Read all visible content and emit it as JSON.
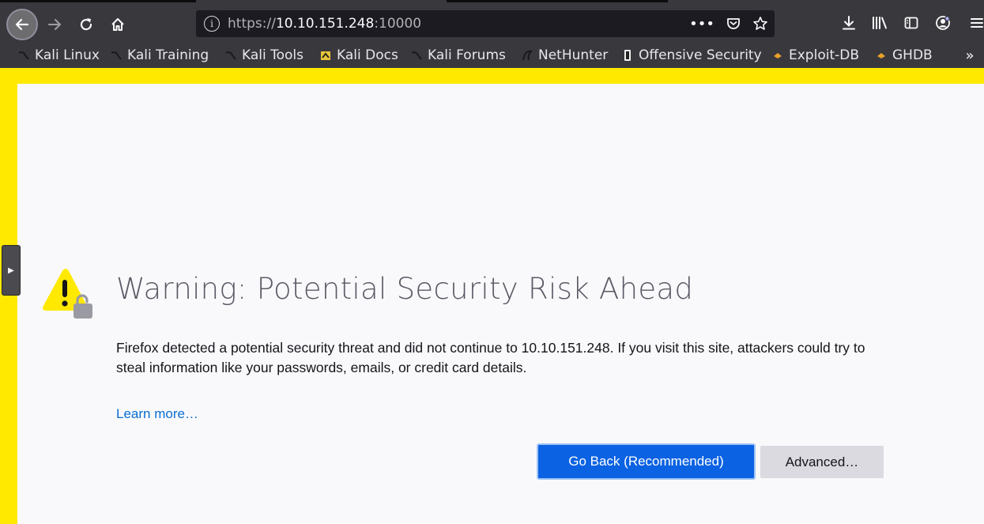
{
  "toolbar": {
    "back_icon": "back-arrow-icon",
    "forward_icon": "forward-arrow-icon",
    "reload_icon": "reload-icon",
    "home_icon": "home-icon"
  },
  "urlbar": {
    "scheme": "https://",
    "host": "10.10.151.248",
    "port": ":10000"
  },
  "bookmarks": [
    {
      "label": "Kali Linux",
      "icon": "kali-dragon-icon"
    },
    {
      "label": "Kali Training",
      "icon": "kali-dragon-icon"
    },
    {
      "label": "Kali Tools",
      "icon": "kali-dragon-icon"
    },
    {
      "label": "Kali Docs",
      "icon": "kali-docs-icon"
    },
    {
      "label": "Kali Forums",
      "icon": "kali-dragon-icon"
    },
    {
      "label": "NetHunter",
      "icon": "nethunter-icon"
    },
    {
      "label": "Offensive Security",
      "icon": "offsec-icon"
    },
    {
      "label": "Exploit-DB",
      "icon": "exploitdb-icon"
    },
    {
      "label": "GHDB",
      "icon": "exploitdb-icon"
    }
  ],
  "page": {
    "title": "Warning: Potential Security Risk Ahead",
    "description": "Firefox detected a potential security threat and did not continue to 10.10.151.248. If you visit this site, attackers could try to steal information like your passwords, emails, or credit card details.",
    "learn_more": "Learn more…",
    "go_back_label": "Go Back (Recommended)",
    "advanced_label": "Advanced…"
  },
  "colors": {
    "toolbar": "#38383d",
    "urlbar": "#1c1b22",
    "warning_border": "#ffe900",
    "primary_button": "#0b62e3",
    "link": "#0a6ed4"
  }
}
